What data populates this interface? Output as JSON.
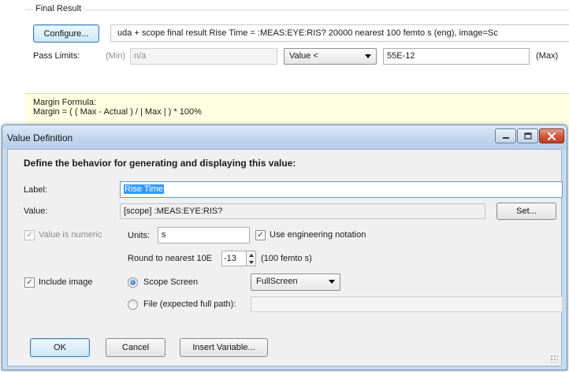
{
  "final_result": {
    "group_title": "Final Result",
    "configure_label": "Configure...",
    "configure_summary": "uda + scope    final result  Rise Time = :MEAS:EYE:RIS?  20000  nearest 100 femto s (eng), image=Sc",
    "pass_limits_label": "Pass Limits:",
    "min_label": "(Min)",
    "min_value": "n/a",
    "operator_value": "Value <",
    "max_value": "55E-12",
    "max_label": "(Max)",
    "margin_line1": "Margin Formula:",
    "margin_line2": "Margin = ( ( Max - Actual ) / | Max | ) * 100%"
  },
  "dialog": {
    "title": "Value Definition",
    "heading": "Define the behavior for generating and displaying this value:",
    "label_caption": "Label:",
    "label_value": "Rise Time",
    "value_caption": "Value:",
    "value_text": "[scope] :MEAS:EYE:RIS?",
    "set_button": "Set...",
    "numeric_label": "Value is numeric",
    "units_caption": "Units:",
    "units_value": "s",
    "engineering_label": "Use engineering notation",
    "round_caption": "Round to nearest 10E",
    "round_value": "-13",
    "round_hint": "(100 femto s)",
    "include_image_label": "Include image",
    "scope_screen_label": "Scope Screen",
    "screen_mode": "FullScreen",
    "file_label": "File (expected full path):",
    "file_value": "",
    "ok_button": "OK",
    "cancel_button": "Cancel",
    "insert_variable_button": "Insert Variable..."
  },
  "state": {
    "value_is_numeric": true,
    "use_engineering_notation": true,
    "include_image": true,
    "image_source": "Scope Screen"
  },
  "icons": [
    "minimize-icon",
    "maximize-icon",
    "close-icon",
    "checkmark-icon",
    "dropdown-arrow-icon",
    "spin-up-icon",
    "spin-down-icon",
    "size-grip-icon"
  ],
  "colors": {
    "title_bar": "#c4d8ef",
    "selection": "#3399ff",
    "margin_box": "#ffffe1",
    "close_button": "#c33b21"
  }
}
